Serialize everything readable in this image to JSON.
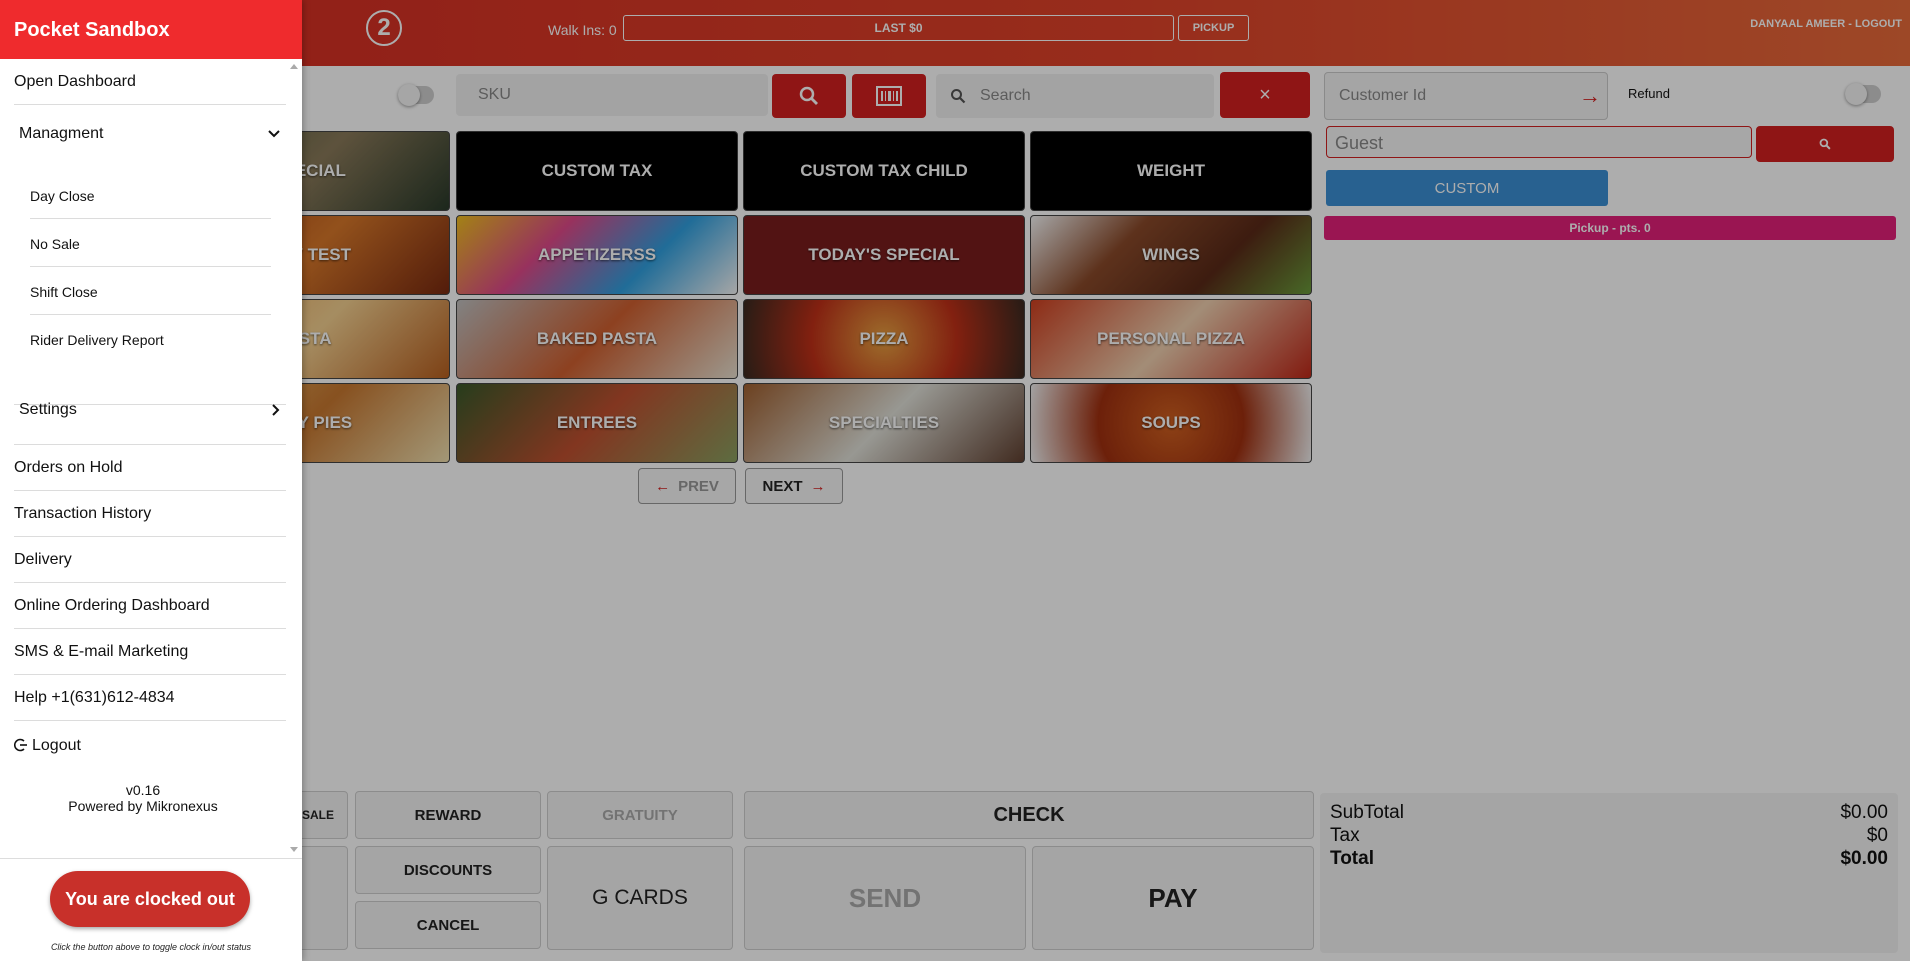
{
  "topbar": {
    "step": "2",
    "walk_ins": "Walk Ins: 0",
    "last": "LAST $0",
    "pickup": "PICKUP",
    "user": "DANYAAL AMEER - LOGOUT"
  },
  "search": {
    "sku_placeholder": "SKU",
    "search_placeholder": "Search",
    "clear": "×",
    "customer_id_placeholder": "Customer Id",
    "refund_label": "Refund",
    "guest_placeholder": "Guest",
    "custom": "CUSTOM",
    "pickup_points": "Pickup - pts. 0"
  },
  "tiles": [
    {
      "label": "SPECIAL"
    },
    {
      "label": "CUSTOM TAX"
    },
    {
      "label": "CUSTOM TAX CHILD"
    },
    {
      "label": "WEIGHT"
    },
    {
      "label": "ORY TEST"
    },
    {
      "label": "APPETIZERSS"
    },
    {
      "label": "TODAY'S SPECIAL"
    },
    {
      "label": "WINGS"
    },
    {
      "label": "ASTA"
    },
    {
      "label": "BAKED PASTA"
    },
    {
      "label": "PIZZA"
    },
    {
      "label": "PERSONAL PIZZA"
    },
    {
      "label": "ALTY PIES"
    },
    {
      "label": "ENTREES"
    },
    {
      "label": "SPECIALTIES"
    },
    {
      "label": "SOUPS"
    }
  ],
  "pager": {
    "prev": "PREV",
    "next": "NEXT"
  },
  "actions": {
    "sale": "SALE",
    "reward": "REWARD",
    "gratuity": "GRATUITY",
    "check": "CHECK",
    "discounts": "DISCOUNTS",
    "cancel": "CANCEL",
    "gcards": "G CARDS",
    "send": "SEND",
    "pay": "PAY"
  },
  "totals": {
    "subtotal_label": "SubTotal",
    "subtotal": "$0.00",
    "tax_label": "Tax",
    "tax": "$0",
    "total_label": "Total",
    "total": "$0.00"
  },
  "drawer": {
    "title": "Pocket Sandbox",
    "open_dashboard": "Open Dashboard",
    "management": "Managment",
    "management_items": [
      "Day Close",
      "No Sale",
      "Shift Close",
      "Rider Delivery Report"
    ],
    "settings": "Settings",
    "items": [
      "Orders on Hold",
      "Transaction History",
      "Delivery",
      "Online Ordering Dashboard",
      "SMS & E-mail Marketing",
      "Help +1(631)612-4834"
    ],
    "logout": "Logout",
    "version": "v0.16",
    "powered_by": "Powered by Mikronexus",
    "clock_button": "You are clocked out",
    "clock_hint": "Click the button above to toggle clock in/out status"
  },
  "colors": {
    "brand_red": "#ef2b2d",
    "topbar": "#d42a22",
    "custom_blue": "#3b8fd4",
    "pickup_pink": "#e3207a",
    "clock_button": "#c8302a"
  }
}
